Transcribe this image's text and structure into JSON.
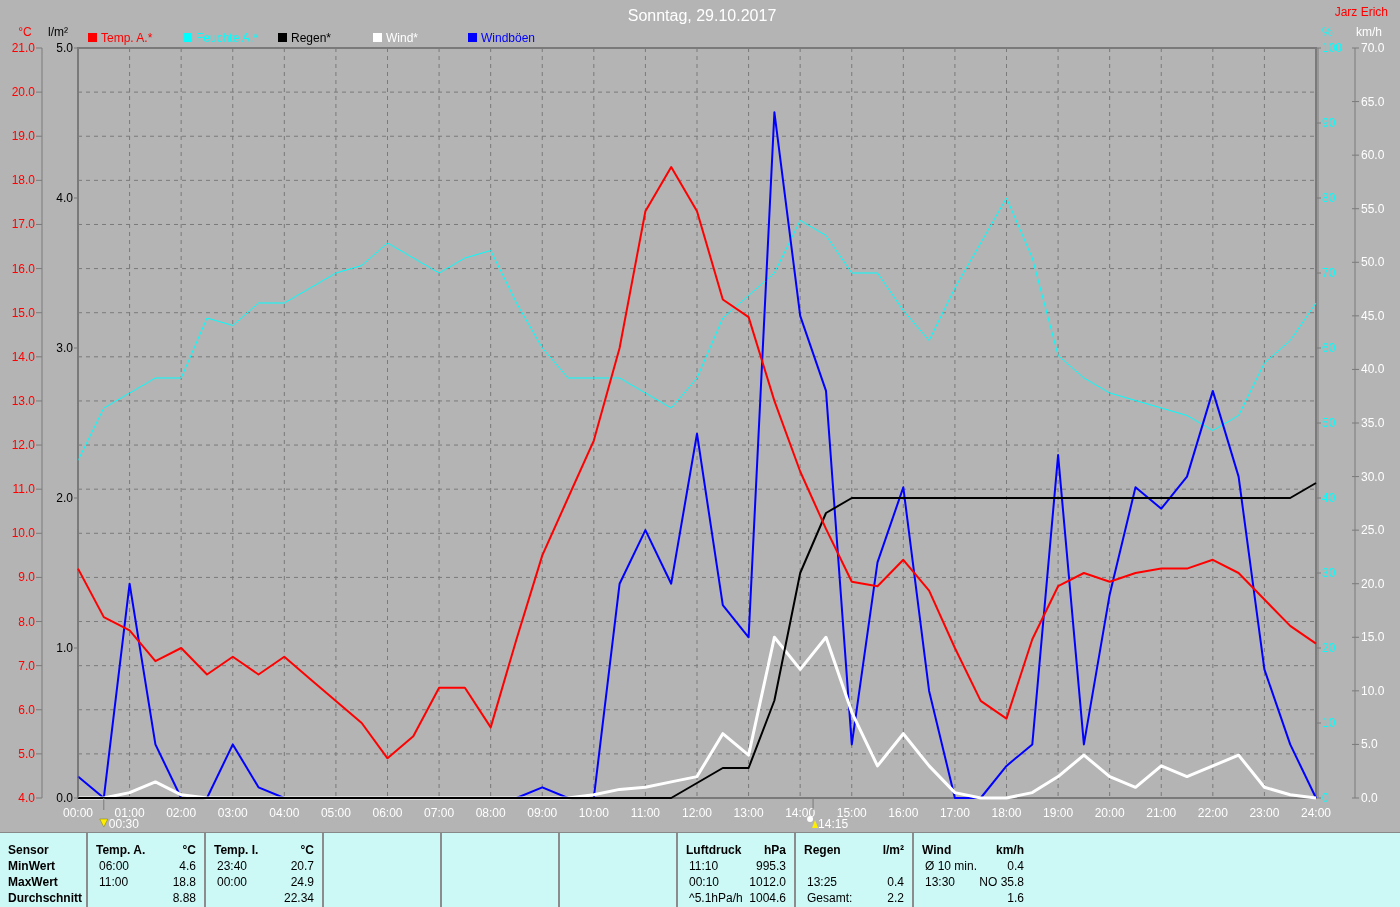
{
  "title": "Sonntag, 29.10.2017",
  "owner": "Jarz Erich",
  "chart": {
    "layers": [
      {
        "chart_data": {
          "type": "line",
          "ylabel": "°C",
          "grid": true,
          "x": [
            0,
            0.5,
            1,
            1.5,
            2,
            2.5,
            3,
            3.5,
            4,
            4.5,
            5,
            5.5,
            6,
            6.5,
            7,
            7.5,
            8,
            8.5,
            9,
            9.5,
            10,
            10.5,
            11,
            11.5,
            12,
            12.5,
            13,
            13.5,
            14,
            14.5,
            15,
            15.5,
            16,
            16.5,
            17,
            17.5,
            18,
            18.5,
            19,
            19.5,
            20,
            20.5,
            21,
            21.5,
            22,
            22.5,
            23,
            23.5,
            24
          ],
          "xlim": [
            0,
            24
          ],
          "ylim": [
            4,
            21
          ],
          "xticks": [
            {
              "value": 0,
              "label": "00:00"
            },
            {
              "value": 1,
              "label": "01:00"
            },
            {
              "value": 2,
              "label": "02:00"
            },
            {
              "value": 3,
              "label": "03:00"
            },
            {
              "value": 4,
              "label": "04:00"
            },
            {
              "value": 5,
              "label": "05:00"
            },
            {
              "value": 6,
              "label": "06:00"
            },
            {
              "value": 7,
              "label": "07:00"
            },
            {
              "value": 8,
              "label": "08:00"
            },
            {
              "value": 9,
              "label": "09:00"
            },
            {
              "value": 10,
              "label": "10:00"
            },
            {
              "value": 11,
              "label": "11:00"
            },
            {
              "value": 12,
              "label": "12:00"
            },
            {
              "value": 13,
              "label": "13:00"
            },
            {
              "value": 14,
              "label": "14:00"
            },
            {
              "value": 15,
              "label": "15:00"
            },
            {
              "value": 16,
              "label": "16:00"
            },
            {
              "value": 17,
              "label": "17:00"
            },
            {
              "value": 18,
              "label": "18:00"
            },
            {
              "value": 19,
              "label": "19:00"
            },
            {
              "value": 20,
              "label": "20:00"
            },
            {
              "value": 21,
              "label": "21:00"
            },
            {
              "value": 22,
              "label": "22:00"
            },
            {
              "value": 23,
              "label": "23:00"
            },
            {
              "value": 24,
              "label": "24:00"
            }
          ],
          "yticks": [
            {
              "value": 21,
              "label": "21.0"
            },
            {
              "value": 20,
              "label": "20.0"
            },
            {
              "value": 19,
              "label": "19.0"
            },
            {
              "value": 18,
              "label": "18.0"
            },
            {
              "value": 17,
              "label": "17.0"
            },
            {
              "value": 16,
              "label": "16.0"
            },
            {
              "value": 15,
              "label": "15.0"
            },
            {
              "value": 14,
              "label": "14.0"
            },
            {
              "value": 13,
              "label": "13.0"
            },
            {
              "value": 12,
              "label": "12.0"
            },
            {
              "value": 11,
              "label": "11.0"
            },
            {
              "value": 10,
              "label": "10.0"
            },
            {
              "value": 9,
              "label": "9.0"
            },
            {
              "value": 8,
              "label": "8.0"
            },
            {
              "value": 7,
              "label": "7.0"
            },
            {
              "value": 6,
              "label": "6.0"
            },
            {
              "value": 5,
              "label": "5.0"
            },
            {
              "value": 4,
              "label": "4.0"
            }
          ],
          "series": [
            {
              "name": "Temp. A.*",
              "color": "#ff0000",
              "values": [
                9.2,
                8.1,
                7.8,
                7.1,
                7.4,
                6.8,
                7.2,
                6.8,
                7.2,
                6.7,
                6.2,
                5.7,
                4.9,
                5.4,
                6.5,
                6.5,
                5.6,
                7.6,
                9.5,
                10.8,
                12.1,
                14.2,
                17.3,
                18.3,
                17.3,
                15.3,
                14.9,
                13.0,
                11.4,
                10.1,
                8.9,
                8.8,
                9.4,
                8.7,
                7.4,
                6.2,
                5.8,
                7.6,
                8.8,
                9.1,
                8.9,
                9.1,
                9.2,
                9.2,
                9.4,
                9.1,
                8.5,
                7.9,
                7.5
              ]
            }
          ]
        }
      },
      {
        "chart_data": {
          "type": "line",
          "ylabel": "%",
          "x": [
            0,
            0.5,
            1,
            1.5,
            2,
            2.5,
            3,
            3.5,
            4,
            4.5,
            5,
            5.5,
            6,
            6.5,
            7,
            7.5,
            8,
            8.5,
            9,
            9.5,
            10,
            10.5,
            11,
            11.5,
            12,
            12.5,
            13,
            13.5,
            14,
            14.5,
            15,
            15.5,
            16,
            16.5,
            17,
            17.5,
            18,
            18.5,
            19,
            19.5,
            20,
            20.5,
            21,
            21.5,
            22,
            22.5,
            23,
            23.5,
            24
          ],
          "xlim": [
            0,
            24
          ],
          "ylim": [
            0,
            100
          ],
          "yticks": [
            {
              "value": 100,
              "label": "100"
            },
            {
              "value": 90,
              "label": "90"
            },
            {
              "value": 80,
              "label": "80"
            },
            {
              "value": 70,
              "label": "70"
            },
            {
              "value": 60,
              "label": "60"
            },
            {
              "value": 50,
              "label": "50"
            },
            {
              "value": 40,
              "label": "40"
            },
            {
              "value": 30,
              "label": "30"
            },
            {
              "value": 20,
              "label": "20"
            },
            {
              "value": 10,
              "label": "10"
            },
            {
              "value": 0,
              "label": "0"
            }
          ],
          "series": [
            {
              "name": "Feuchte A.*",
              "color": "#00ffff",
              "values": [
                45,
                52,
                54,
                56,
                56,
                64,
                63,
                66,
                66,
                68,
                70,
                71,
                74,
                72,
                70,
                72,
                73,
                66,
                60,
                56,
                56,
                56,
                54,
                52,
                56,
                64,
                67,
                70,
                77,
                75,
                70,
                70,
                65,
                61,
                68,
                74,
                80,
                72,
                59,
                56,
                54,
                53,
                52,
                51,
                49,
                51,
                58,
                61,
                66
              ]
            }
          ]
        }
      },
      {
        "chart_data": {
          "type": "line",
          "ylabel": "l/m²",
          "x": [
            0,
            0.5,
            1,
            1.5,
            2,
            2.5,
            3,
            3.5,
            4,
            4.5,
            5,
            5.5,
            6,
            6.5,
            7,
            7.5,
            8,
            8.5,
            9,
            9.5,
            10,
            10.5,
            11,
            11.5,
            12,
            12.5,
            13,
            13.5,
            14,
            14.5,
            15,
            15.5,
            16,
            16.5,
            17,
            17.5,
            18,
            18.5,
            19,
            19.5,
            20,
            20.5,
            21,
            21.5,
            22,
            22.5,
            23,
            23.5,
            24
          ],
          "xlim": [
            0,
            24
          ],
          "ylim": [
            0,
            5
          ],
          "yticks": [
            {
              "value": 5,
              "label": "5.0"
            },
            {
              "value": 4,
              "label": "4.0"
            },
            {
              "value": 3,
              "label": "3.0"
            },
            {
              "value": 2,
              "label": "2.0"
            },
            {
              "value": 1,
              "label": "1.0"
            },
            {
              "value": 0,
              "label": "0.0"
            }
          ],
          "series": [
            {
              "name": "Regen*",
              "color": "#000000",
              "values": [
                0,
                0,
                0,
                0,
                0,
                0,
                0,
                0,
                0,
                0,
                0,
                0,
                0,
                0,
                0,
                0,
                0,
                0,
                0,
                0,
                0,
                0,
                0,
                0,
                0.1,
                0.2,
                0.2,
                0.65,
                1.5,
                1.9,
                2.0,
                2.0,
                2.0,
                2.0,
                2.0,
                2.0,
                2.0,
                2.0,
                2.0,
                2.0,
                2.0,
                2.0,
                2.0,
                2.0,
                2.0,
                2.0,
                2.0,
                2.0,
                2.1
              ]
            }
          ]
        }
      },
      {
        "chart_data": {
          "type": "line",
          "ylabel": "km/h",
          "x": [
            0,
            0.5,
            1,
            1.5,
            2,
            2.5,
            3,
            3.5,
            4,
            4.5,
            5,
            5.5,
            6,
            6.5,
            7,
            7.5,
            8,
            8.5,
            9,
            9.5,
            10,
            10.5,
            11,
            11.5,
            12,
            12.5,
            13,
            13.5,
            14,
            14.5,
            15,
            15.5,
            16,
            16.5,
            17,
            17.5,
            18,
            18.5,
            19,
            19.5,
            20,
            20.5,
            21,
            21.5,
            22,
            22.5,
            23,
            23.5,
            24
          ],
          "xlim": [
            0,
            24
          ],
          "ylim": [
            0,
            70
          ],
          "yticks": [
            {
              "value": 70,
              "label": "70.0"
            },
            {
              "value": 65,
              "label": "65.0"
            },
            {
              "value": 60,
              "label": "60.0"
            },
            {
              "value": 55,
              "label": "55.0"
            },
            {
              "value": 50,
              "label": "50.0"
            },
            {
              "value": 45,
              "label": "45.0"
            },
            {
              "value": 40,
              "label": "40.0"
            },
            {
              "value": 35,
              "label": "35.0"
            },
            {
              "value": 30,
              "label": "30.0"
            },
            {
              "value": 25,
              "label": "25.0"
            },
            {
              "value": 20,
              "label": "20.0"
            },
            {
              "value": 15,
              "label": "15.0"
            },
            {
              "value": 10,
              "label": "10.0"
            },
            {
              "value": 5,
              "label": "5.0"
            },
            {
              "value": 0,
              "label": "0.0"
            }
          ],
          "series": [
            {
              "name": "Wind*",
              "color": "#ffffff",
              "values": [
                0,
                0,
                0.5,
                1.5,
                0.3,
                0,
                0,
                0,
                0,
                0,
                0,
                0,
                0,
                0,
                0,
                0,
                0,
                0,
                0,
                0,
                0.3,
                0.8,
                1,
                1.5,
                2,
                6,
                4,
                15,
                12,
                15,
                8,
                3,
                6,
                3,
                0.5,
                0,
                0,
                0.5,
                2,
                4,
                2,
                1,
                3,
                2,
                3,
                4,
                1,
                0.3,
                0
              ]
            },
            {
              "name": "Windböen",
              "color": "#0000ff",
              "values": [
                2,
                0,
                20,
                5,
                0,
                0,
                5,
                1,
                0,
                0,
                0,
                0,
                0,
                0,
                0,
                0,
                0,
                0,
                1,
                0,
                0,
                20,
                25,
                20,
                34,
                18,
                15,
                64,
                45,
                38,
                5,
                22,
                29,
                10,
                0,
                0,
                3,
                5,
                32,
                5,
                19,
                29,
                27,
                30,
                38,
                30,
                12,
                5,
                0
              ]
            }
          ]
        }
      }
    ],
    "events": [
      {
        "kind": "sunrise",
        "label": "00:30"
      },
      {
        "kind": "moonrise",
        "label": "14:15"
      }
    ]
  },
  "stats": {
    "row_labels": [
      "Sensor",
      "MinWert",
      "MaxWert",
      "Durchschnitt"
    ],
    "groups": [
      {
        "kind": "data",
        "name": "Temp. A.",
        "unit": "°C",
        "rows": [
          {
            "time": "06:00",
            "value": "4.6"
          },
          {
            "time": "11:00",
            "value": "18.8"
          },
          {
            "value": "8.88"
          }
        ]
      },
      {
        "kind": "data",
        "name": "Temp. I.",
        "unit": "°C",
        "rows": [
          {
            "time": "23:40",
            "value": "20.7"
          },
          {
            "time": "00:00",
            "value": "24.9"
          },
          {
            "value": "22.34"
          }
        ]
      },
      {
        "kind": "empty"
      },
      {
        "kind": "empty"
      },
      {
        "kind": "empty"
      },
      {
        "kind": "data",
        "name": "Luftdruck",
        "unit": "hPa",
        "rows": [
          {
            "time": "11:10",
            "value": "995.3"
          },
          {
            "time": "00:10",
            "value": "1012.0"
          },
          {
            "time": "^5.1hPa/h",
            "value": "1004.6"
          }
        ]
      },
      {
        "kind": "data",
        "name": "Regen",
        "unit": "l/m²",
        "rows": [
          {},
          {
            "time": "13:25",
            "value": "0.4"
          },
          {
            "time": "Gesamt:",
            "value": "2.2"
          }
        ]
      },
      {
        "kind": "data",
        "name": "Wind",
        "unit": "km/h",
        "rows": [
          {
            "time": "Ø 10 min.",
            "value": "0.4"
          },
          {
            "time": "13:30",
            "value": "NO 35.8"
          },
          {
            "value": "1.6"
          }
        ]
      }
    ]
  }
}
